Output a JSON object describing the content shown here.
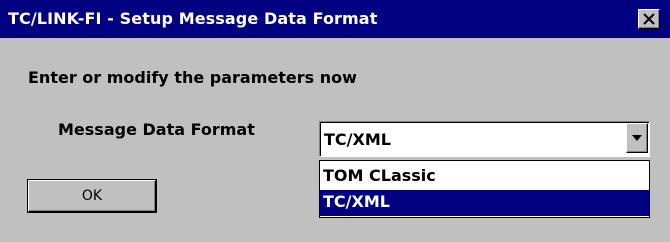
{
  "window": {
    "title": "TC/LINK-FI - Setup Message Data Format",
    "close_glyph": "×"
  },
  "dialog": {
    "prompt": "Enter or modify the parameters now",
    "field_label": "Message Data Format",
    "selected_value": "TC/XML",
    "options": [
      "TOM CLassic",
      "TC/XML"
    ],
    "highlighted_option": "TC/XML",
    "ok_label": "OK"
  },
  "colors": {
    "titlebar": "#000080",
    "window_bg": "#c0c0c0",
    "highlight": "#000080"
  },
  "icons": [
    "close-icon",
    "chevron-down-icon"
  ]
}
